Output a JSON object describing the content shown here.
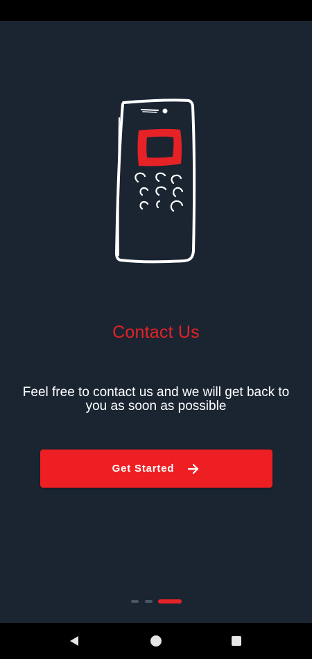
{
  "onboarding": {
    "title": "Contact Us",
    "description": "Feel free to contact us and we will get back to you as soon as possible",
    "cta_label": "Get Started",
    "cta_icon": "arrow-right-icon",
    "illustration": "phone-illustration",
    "page_indicator": {
      "total": 3,
      "current": 3
    }
  },
  "colors": {
    "background": "#1b2532",
    "accent": "#e52226",
    "text": "#ffffff"
  },
  "system_nav": {
    "back_icon": "back-triangle-icon",
    "home_icon": "home-circle-icon",
    "recents_icon": "recents-square-icon"
  }
}
